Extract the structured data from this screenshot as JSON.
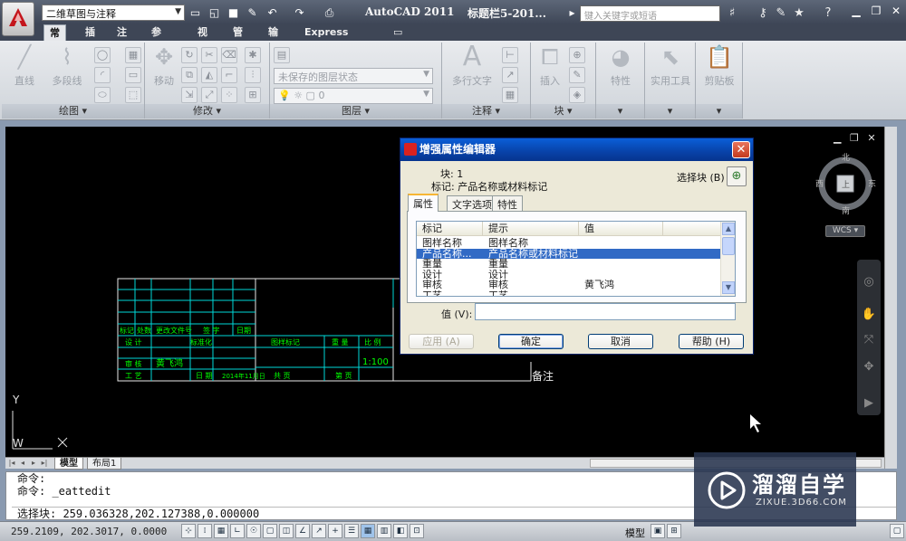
{
  "titlebar": {
    "workspace": "二维草图与注释",
    "app_title": "AutoCAD 2011",
    "doc_title": "标题栏5-201...",
    "search_placeholder": "键入关键字或短语"
  },
  "tabs": [
    "常用",
    "插入",
    "注释",
    "参数化",
    "视图",
    "管理",
    "输出",
    "Express Tools"
  ],
  "ribbon": {
    "draw": {
      "title": "绘图",
      "line": "直线",
      "polyline": "多段线"
    },
    "modify": {
      "title": "修改",
      "move": "移动"
    },
    "layer": {
      "title": "图层",
      "layer_state": "未保存的图层状态",
      "current_layer": "0"
    },
    "annotation": {
      "title": "注释",
      "mtext": "多行文字"
    },
    "block": {
      "title": "块",
      "insert": "插入"
    },
    "properties": {
      "label": "特性"
    },
    "utilities": {
      "label": "实用工具"
    },
    "clipboard": {
      "label": "剪贴板"
    }
  },
  "drawing": {
    "title_block": {
      "row_labels": [
        "标记",
        "处数",
        "更改文件号",
        "签 字",
        "日期"
      ],
      "designer_label": "设 计",
      "standard_label": "标准化",
      "stage_label": "图样标记",
      "weight_label": "重 量",
      "scale_label": "比 例",
      "reviewer_label": "审 核",
      "reviewer_name": "黄飞鸿",
      "process_label": "工 艺",
      "date_label": "日 期",
      "date_value": "2014年11月日",
      "total_label": "共  页",
      "sheet_label": "第  页",
      "scale_value": "1:100",
      "remark": "备注"
    },
    "ucs_y": "Y",
    "ucs_w": "W",
    "viewcube": {
      "north": "北",
      "south": "南",
      "west": "西",
      "east": "东",
      "top": "上"
    },
    "wcs": "WCS"
  },
  "layout_tabs": [
    "模型",
    "布局1"
  ],
  "command_line": {
    "line1": "命令:",
    "line2": "命令: _eattedit",
    "prompt": "选择块: 259.036328,202.127388,0.000000"
  },
  "status": {
    "coords": "259.2109, 202.3017, 0.0000",
    "model": "模型"
  },
  "dialog": {
    "title": "增强属性编辑器",
    "block_label": "块: 1",
    "tag_label": "标记: 产品名称或材料标记",
    "select_block": "选择块 (B)",
    "tabs": [
      "属性",
      "文字选项",
      "特性"
    ],
    "columns": [
      "标记",
      "提示",
      "值"
    ],
    "rows": [
      {
        "tag": "图样名称",
        "prompt": "图样名称",
        "value": ""
      },
      {
        "tag": "产品名称...",
        "prompt": "产品名称或材料标记",
        "value": "",
        "selected": true
      },
      {
        "tag": "重量",
        "prompt": "重量",
        "value": ""
      },
      {
        "tag": "设计",
        "prompt": "设计",
        "value": ""
      },
      {
        "tag": "审核",
        "prompt": "审核",
        "value": "黄飞鸿"
      },
      {
        "tag": "工艺",
        "prompt": "工艺",
        "value": ""
      }
    ],
    "value_label": "值 (V):",
    "value": "",
    "buttons": {
      "apply": "应用 (A)",
      "ok": "确定",
      "cancel": "取消",
      "help": "帮助 (H)"
    }
  },
  "watermark": {
    "name": "溜溜自学",
    "url": "ZIXUE.3D66.COM"
  },
  "colors": {
    "accent": "#316ac5",
    "title_block_line": "#00e0e0",
    "label_green": "#00ff00",
    "canvas": "#000000"
  }
}
